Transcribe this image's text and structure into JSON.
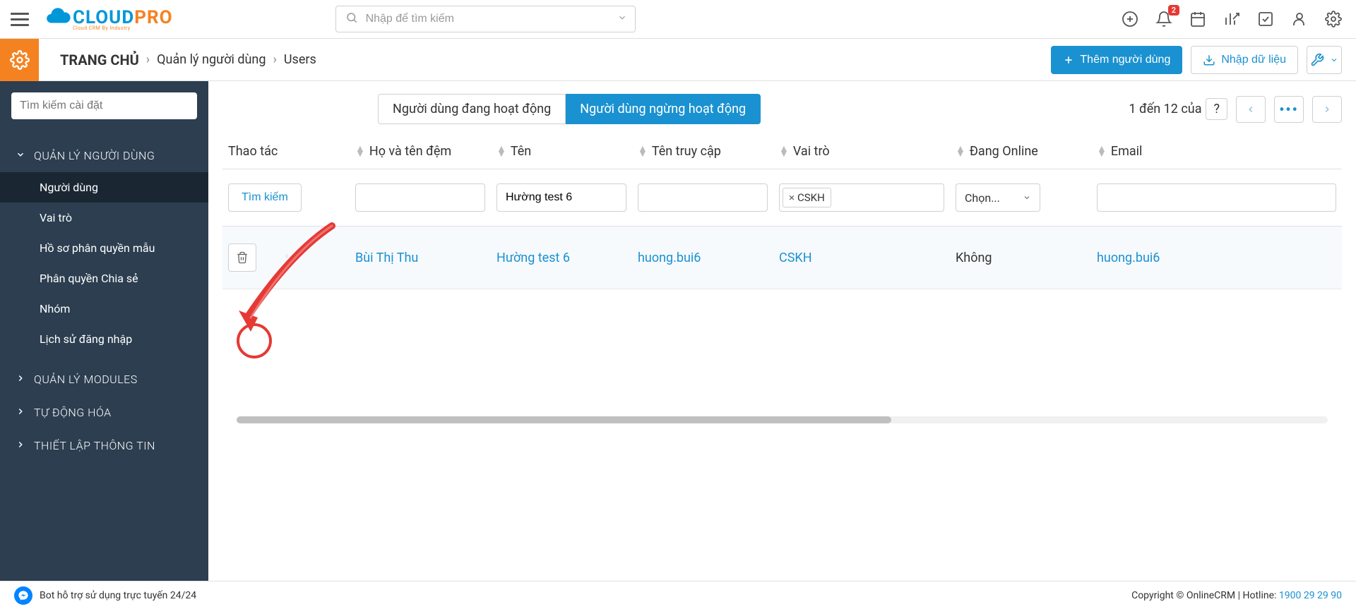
{
  "header": {
    "search_placeholder": "Nhập để tìm kiếm",
    "badge_count": "2"
  },
  "logo": {
    "text_cloud": "CLOUD",
    "text_pro": "PRO",
    "subtitle": "Cloud CRM By Industry"
  },
  "breadcrumb": {
    "home": "TRANG CHỦ",
    "item1": "Quản lý người dùng",
    "item2": "Users"
  },
  "actions": {
    "add_user": "Thêm người dùng",
    "import": "Nhập dữ liệu"
  },
  "sidebar": {
    "search_placeholder": "Tìm kiếm cài đặt",
    "sections": {
      "user_mgmt": "QUẢN LÝ NGƯỜI DÙNG",
      "modules": "QUẢN LÝ MODULES",
      "automation": "TỰ ĐỘNG HÓA",
      "settings": "THIẾT LẬP THÔNG TIN"
    },
    "items": {
      "users": "Người dùng",
      "roles": "Vai trò",
      "profiles": "Hồ sơ phân quyền mẫu",
      "sharing": "Phân quyền Chia sẻ",
      "groups": "Nhóm",
      "login_history": "Lịch sử đăng nhập"
    }
  },
  "tabs": {
    "active_users": "Người dùng đang hoạt động",
    "inactive_users": "Người dùng ngừng hoạt động"
  },
  "pager": {
    "text_prefix": "1 đến 12 của",
    "unknown": "?"
  },
  "columns": {
    "action": "Thao tác",
    "last_name": "Họ và tên đệm",
    "first_name": "Tên",
    "username": "Tên truy cập",
    "role": "Vai trò",
    "online": "Đang Online",
    "email": "Email"
  },
  "filters": {
    "search_btn": "Tìm kiếm",
    "first_name_value": "Hường test 6",
    "role_chip": "CSKH",
    "online_select": "Chọn..."
  },
  "row": {
    "last_name": "Bùi Thị Thu",
    "first_name": "Hường test 6",
    "username": "huong.bui6",
    "role": "CSKH",
    "online": "Không",
    "email": "huong.bui6"
  },
  "footer": {
    "bot_text": "Bot hỗ trợ sử dụng trực tuyến 24/24",
    "copyright": "Copyright © OnlineCRM",
    "hotline_label": "Hotline:",
    "hotline_number": "1900 29 29 90"
  }
}
